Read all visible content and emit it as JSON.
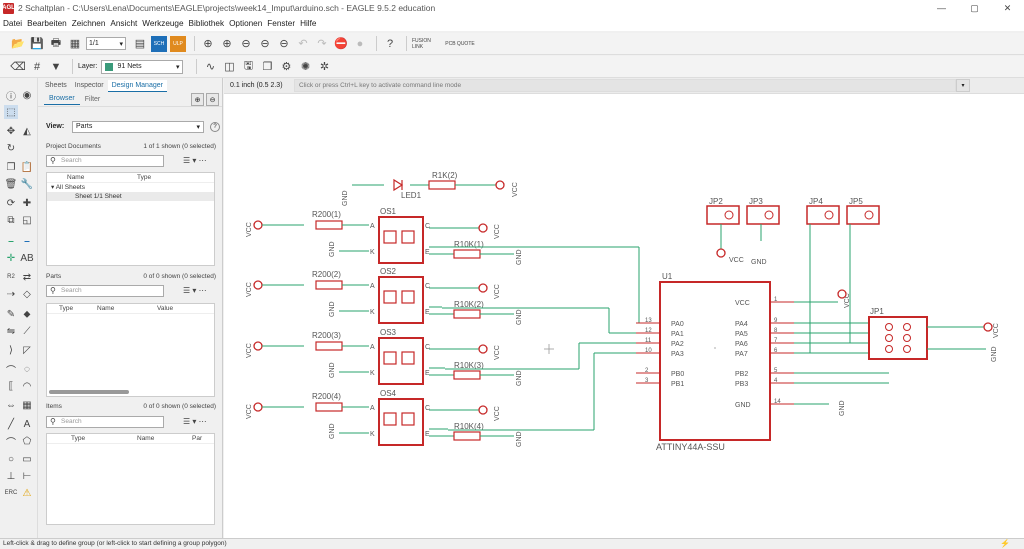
{
  "window": {
    "title": "2 Schaltplan - C:\\Users\\Lena\\Documents\\EAGLE\\projects\\week14_Imput\\arduino.sch - EAGLE 9.5.2 education",
    "icon": "EAGLE"
  },
  "menu": [
    "Datei",
    "Bearbeiten",
    "Zeichnen",
    "Ansicht",
    "Werkzeuge",
    "Bibliothek",
    "Optionen",
    "Fenster",
    "Hilfe"
  ],
  "toolbar": {
    "sheet_value": "1/1",
    "layer_label": "Layer:",
    "layer_value": "91 Nets",
    "layer_color": "#3a9a7a",
    "fusion_label": "FUSION LINK",
    "pcb_label": "PCB QUOTE"
  },
  "panel": {
    "tabs": [
      "Sheets",
      "Inspector",
      "Design Manager"
    ],
    "subtabs": [
      "Browser",
      "Filter"
    ],
    "view_label": "View:",
    "view_value": "Parts",
    "project_documents": {
      "title": "Project Documents",
      "count": "1 of 1 shown (0 selected)",
      "search_placeholder": "Search",
      "columns": [
        "Name",
        "Type"
      ],
      "rows": [
        "All Sheets",
        "Sheet 1/1  Sheet"
      ]
    },
    "parts": {
      "title": "Parts",
      "count": "0 of 0 shown (0 selected)",
      "search_placeholder": "Search",
      "columns": [
        "Type",
        "Name",
        "Value"
      ]
    },
    "items": {
      "title": "Items",
      "count": "0 of 0 shown (0 selected)",
      "search_placeholder": "Search",
      "columns": [
        "Type",
        "Name",
        "Par"
      ]
    }
  },
  "canvas": {
    "coordinate": "0.1 inch (0.5 2.3)",
    "command_placeholder": "Click or press Ctrl+L key to activate command line mode",
    "colors": {
      "net": "#2aa36e",
      "part": "#c62828",
      "text": "#555555"
    }
  },
  "schematic": {
    "led": {
      "name": "LED1",
      "resistor": "R1K(2)"
    },
    "opto_names": [
      "OS1",
      "OS2",
      "OS3",
      "OS4"
    ],
    "r200": [
      "R200(1)",
      "R200(2)",
      "R200(3)",
      "R200(4)"
    ],
    "r10k": [
      "R10K(1)",
      "R10K(2)",
      "R10K(3)",
      "R10K(4)"
    ],
    "jumpers": [
      "JP2",
      "JP3",
      "JP4",
      "JP5"
    ],
    "mcu": {
      "ref": "U1",
      "name": "ATTINY44A-SSU",
      "left_pins": [
        "PA0",
        "PA1",
        "PA2",
        "PA3",
        "PB0",
        "PB1"
      ],
      "left_nums": [
        "13",
        "12",
        "11",
        "10",
        "2",
        "3"
      ],
      "right_pins": [
        "VCC",
        "PA4",
        "PA5",
        "PA6",
        "PA7",
        "PB2",
        "PB3",
        "GND"
      ],
      "right_nums": [
        "1",
        "9",
        "8",
        "7",
        "6",
        "5",
        "4",
        "14"
      ]
    },
    "jp1": "JP1",
    "vcc": "VCC",
    "gnd": "GND",
    "pin_a": "A",
    "pin_k": "K",
    "pin_c": "C",
    "pin_e": "E"
  },
  "status": "Left-click & drag to define group (or left-click to start defining a group polygon)"
}
